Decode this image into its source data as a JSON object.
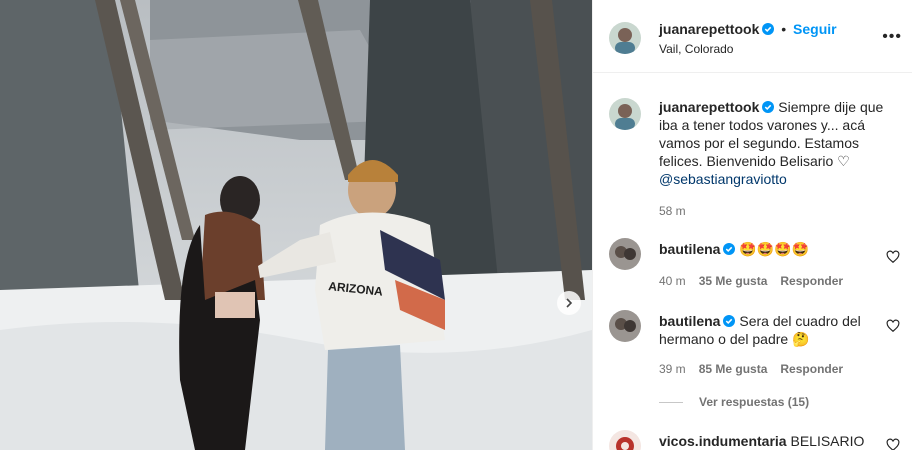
{
  "post": {
    "author": "juanarepettook",
    "location": "Vail, Colorado",
    "follow_label": "Seguir",
    "more_label": "•••",
    "caption_lines": [
      "Siempre dije que",
      "iba a tener todos varones y... acá",
      "vamos por el segundo. Estamos",
      "felices. Bienvenido Belisario ♡"
    ],
    "caption_mention": "@sebastiangraviotto",
    "caption_time": "58 m"
  },
  "comments": [
    {
      "user": "bautilena",
      "text": "🤩🤩🤩🤩",
      "time": "40 m",
      "likes": "35 Me gusta",
      "reply": "Responder"
    },
    {
      "user": "bautilena",
      "text_line1": "Sera del cuadro del",
      "text_line2": "hermano o del padre 🤔",
      "time": "39 m",
      "likes": "85 Me gusta",
      "reply": "Responder",
      "view_replies": "Ver respuestas (15)"
    },
    {
      "user": "vicos.indumentaria",
      "text": "BELISARIO"
    }
  ],
  "colors": {
    "accent": "#0095f6",
    "verified": "#0095f6",
    "mention": "#00376b",
    "muted": "#737373"
  }
}
